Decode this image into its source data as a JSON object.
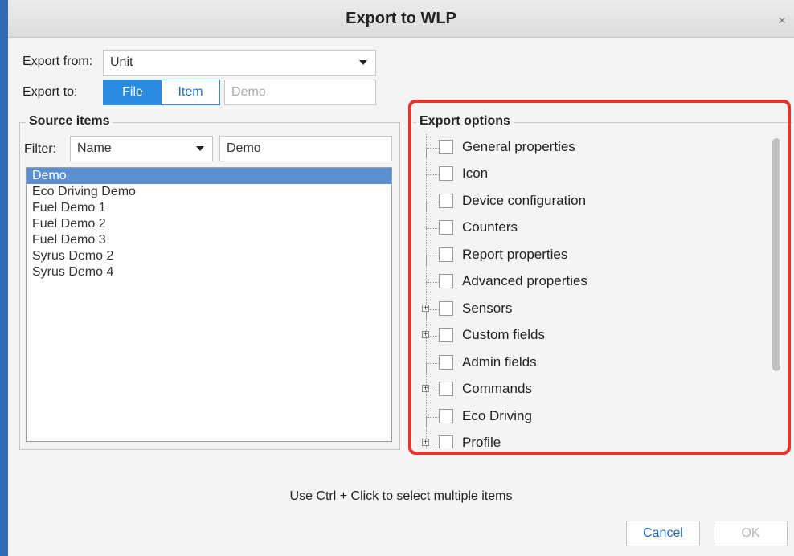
{
  "dialog": {
    "title": "Export to WLP",
    "close_glyph": "×"
  },
  "export_from": {
    "label": "Export from:",
    "value": "Unit"
  },
  "export_to": {
    "label": "Export to:",
    "options": [
      "File",
      "Item"
    ],
    "selected": "File",
    "name_placeholder": "Demo"
  },
  "source": {
    "title": "Source items",
    "filter_label": "Filter:",
    "filter_field": "Name",
    "filter_value": "Demo",
    "items": [
      "Demo",
      "Eco Driving Demo",
      "Fuel Demo 1",
      "Fuel Demo 2",
      "Fuel Demo 3",
      "Syrus Demo 2",
      "Syrus Demo 4"
    ],
    "selected_index": 0
  },
  "options": {
    "title": "Export options",
    "items": [
      {
        "label": "General properties",
        "expandable": false,
        "checked": false
      },
      {
        "label": "Icon",
        "expandable": false,
        "checked": false
      },
      {
        "label": "Device configuration",
        "expandable": false,
        "checked": false
      },
      {
        "label": "Counters",
        "expandable": false,
        "checked": false
      },
      {
        "label": "Report properties",
        "expandable": false,
        "checked": false
      },
      {
        "label": "Advanced properties",
        "expandable": false,
        "checked": false
      },
      {
        "label": "Sensors",
        "expandable": true,
        "checked": false
      },
      {
        "label": "Custom fields",
        "expandable": true,
        "checked": false
      },
      {
        "label": "Admin fields",
        "expandable": false,
        "checked": false
      },
      {
        "label": "Commands",
        "expandable": true,
        "checked": false
      },
      {
        "label": "Eco Driving",
        "expandable": false,
        "checked": false
      },
      {
        "label": "Profile",
        "expandable": true,
        "checked": false
      }
    ],
    "expand_glyph": "+"
  },
  "hint": "Use Ctrl + Click to select multiple items",
  "buttons": {
    "cancel": "Cancel",
    "ok": "OK"
  },
  "colors": {
    "accent": "#2a8be0",
    "highlight": "#e0362c",
    "selection": "#5b8fcf"
  }
}
